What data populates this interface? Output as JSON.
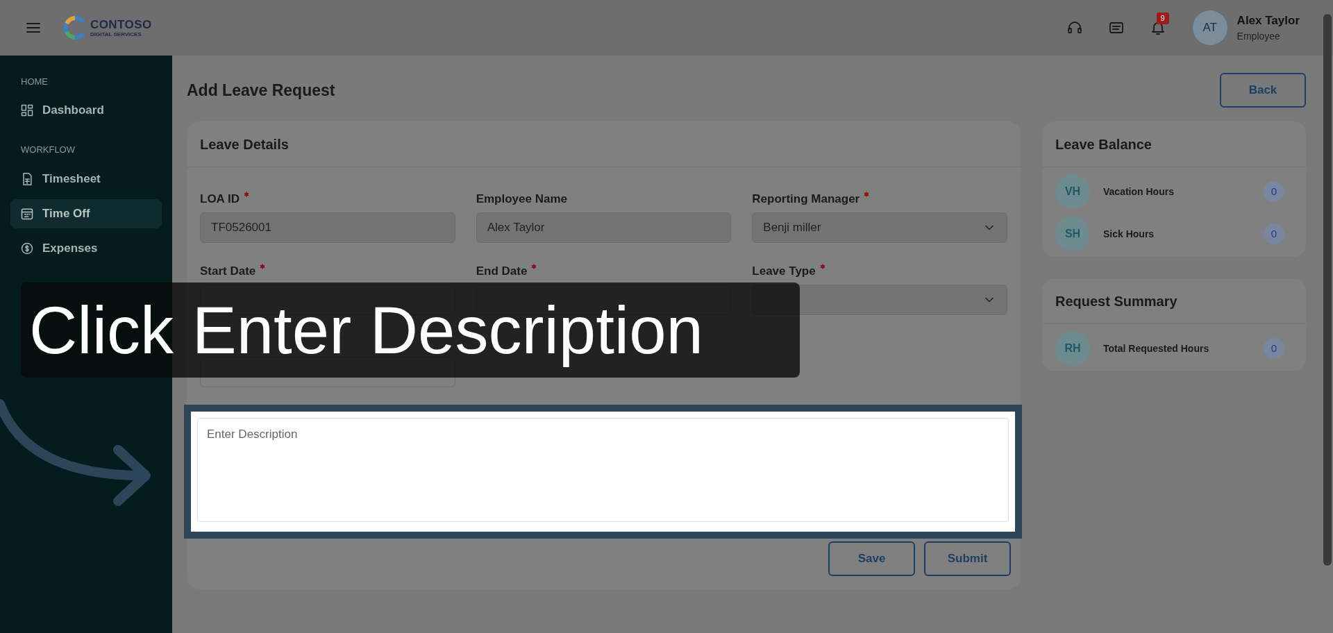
{
  "header": {
    "logo": {
      "name": "CONTOSO",
      "tagline": "DIGITAL SERVICES"
    },
    "notification_count": "9",
    "user": {
      "initials": "AT",
      "name": "Alex Taylor",
      "role": "Employee"
    }
  },
  "sidebar": {
    "sections": [
      {
        "heading": "HOME",
        "items": [
          {
            "label": "Dashboard",
            "selected": false
          }
        ]
      },
      {
        "heading": "WORKFLOW",
        "items": [
          {
            "label": "Timesheet",
            "selected": false
          },
          {
            "label": "Time Off",
            "selected": true
          },
          {
            "label": "Expenses",
            "selected": false
          }
        ]
      }
    ]
  },
  "page_title": "Add Leave Request",
  "back_button": "Back",
  "leave_details": {
    "title": "Leave Details",
    "fields": [
      {
        "label": "LOA ID",
        "required": true,
        "kind": "readonly",
        "value": "TF0526001"
      },
      {
        "label": "Employee Name",
        "required": false,
        "kind": "readonly",
        "value": "Alex Taylor"
      },
      {
        "label": "Reporting Manager",
        "required": true,
        "kind": "select",
        "value": "Benji miller"
      },
      {
        "label": "Start Date",
        "required": true,
        "kind": "date"
      },
      {
        "label": "End Date",
        "required": true,
        "kind": "date"
      },
      {
        "label": "Leave Type",
        "required": true,
        "kind": "select"
      },
      {
        "kind": "text"
      }
    ],
    "notes": {
      "placeholder": "Enter Description"
    },
    "buttons": [
      "Save",
      "Submit"
    ]
  },
  "leave_balance": {
    "title": "Leave Balance",
    "rows": [
      {
        "initials": "VH",
        "label": "Vacation Hours",
        "value": "0"
      },
      {
        "initials": "SH",
        "label": "Sick Hours",
        "value": "0"
      }
    ]
  },
  "request_summary": {
    "title": "Request Summary",
    "rows": [
      {
        "initials": "RH",
        "label": "Total Requested Hours",
        "value": "0"
      }
    ]
  },
  "tutorial": {
    "caption": "Click Enter Description"
  }
}
